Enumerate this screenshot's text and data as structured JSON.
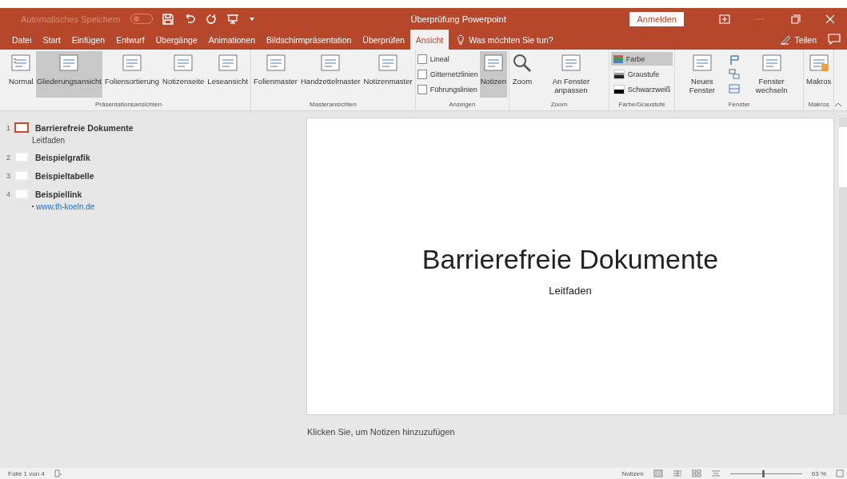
{
  "title_bar": {
    "autosave_label": "Automatisches Speichern",
    "autosave_on": false,
    "title": "Überprüfung Powerpoint",
    "signin_button": "Anmelden"
  },
  "ribbon_tabs": [
    {
      "label": "Datei",
      "selected": false
    },
    {
      "label": "Start",
      "selected": false
    },
    {
      "label": "Einfügen",
      "selected": false
    },
    {
      "label": "Entwurf",
      "selected": false
    },
    {
      "label": "Übergänge",
      "selected": false
    },
    {
      "label": "Animationen",
      "selected": false
    },
    {
      "label": "Bildschirmpräsentation",
      "selected": false
    },
    {
      "label": "Überprüfen",
      "selected": false
    },
    {
      "label": "Ansicht",
      "selected": true
    }
  ],
  "tell_me": "Was möchten Sie tun?",
  "share_button": "Teilen",
  "ribbon_groups": [
    {
      "label": "Präsentationsansichten",
      "items": [
        {
          "kind": "large",
          "label": "Normal",
          "selected": false
        },
        {
          "kind": "large",
          "label": "Gliederungsansicht",
          "selected": true
        },
        {
          "kind": "large",
          "label": "Foliensortierung",
          "selected": false
        },
        {
          "kind": "large",
          "label": "Notizenseite",
          "selected": false
        },
        {
          "kind": "large",
          "label": "Leseansicht",
          "selected": false
        }
      ]
    },
    {
      "label": "Masteransichten",
      "items": [
        {
          "kind": "large",
          "label": "Folienmaster",
          "selected": false
        },
        {
          "kind": "large",
          "label": "Handzettelmaster",
          "selected": false
        },
        {
          "kind": "large",
          "label": "Notizenmaster",
          "selected": false
        }
      ]
    },
    {
      "label": "Anzeigen",
      "items": [
        {
          "kind": "checks",
          "checks": [
            {
              "label": "Lineal",
              "checked": false
            },
            {
              "label": "Gitternetzlinien",
              "checked": false
            },
            {
              "label": "Führungslinien",
              "checked": false
            }
          ]
        },
        {
          "kind": "large",
          "label": "Notizen",
          "selected": true
        }
      ]
    },
    {
      "label": "Zoom",
      "items": [
        {
          "kind": "large",
          "label": "Zoom",
          "selected": false
        },
        {
          "kind": "large",
          "label": "An Fenster anpassen",
          "selected": false
        }
      ]
    },
    {
      "label": "Farbe/Graustufe",
      "items": [
        {
          "kind": "small",
          "smalls": [
            {
              "label": "Farbe",
              "selected": true
            },
            {
              "label": "Graustufe",
              "selected": false
            },
            {
              "label": "Schwarzweiß",
              "selected": false
            }
          ]
        }
      ]
    },
    {
      "label": "Fenster",
      "items": [
        {
          "kind": "large",
          "label": "Neues Fenster",
          "selected": false
        },
        {
          "kind": "icons"
        },
        {
          "kind": "large",
          "label": "Fenster wechseln",
          "selected": false
        }
      ]
    },
    {
      "label": "Makros",
      "items": [
        {
          "kind": "large",
          "label": "Makros",
          "selected": false
        }
      ]
    }
  ],
  "outline": [
    {
      "number": "1",
      "title": "Barrierefreie Dokumente",
      "selected": true,
      "children": [
        {
          "kind": "text",
          "text": "Leitfaden"
        }
      ]
    },
    {
      "number": "2",
      "title": "Beispielgrafik",
      "selected": false
    },
    {
      "number": "3",
      "title": "Beispieltabelle",
      "selected": false
    },
    {
      "number": "4",
      "title": "Beispiellink",
      "selected": false,
      "children": [
        {
          "kind": "link",
          "text": "www.th-koeln.de"
        }
      ]
    }
  ],
  "slide": {
    "title": "Barrierefreie Dokumente",
    "subtitle": "Leitfaden"
  },
  "notes_placeholder": "Klicken Sie, um Notizen hinzuzufügen",
  "status_bar": {
    "slide_info": "Folie 1 von 4",
    "notes_button": "Notizen",
    "zoom": {
      "level": 0.45
    },
    "zoom_label": "63 %"
  }
}
